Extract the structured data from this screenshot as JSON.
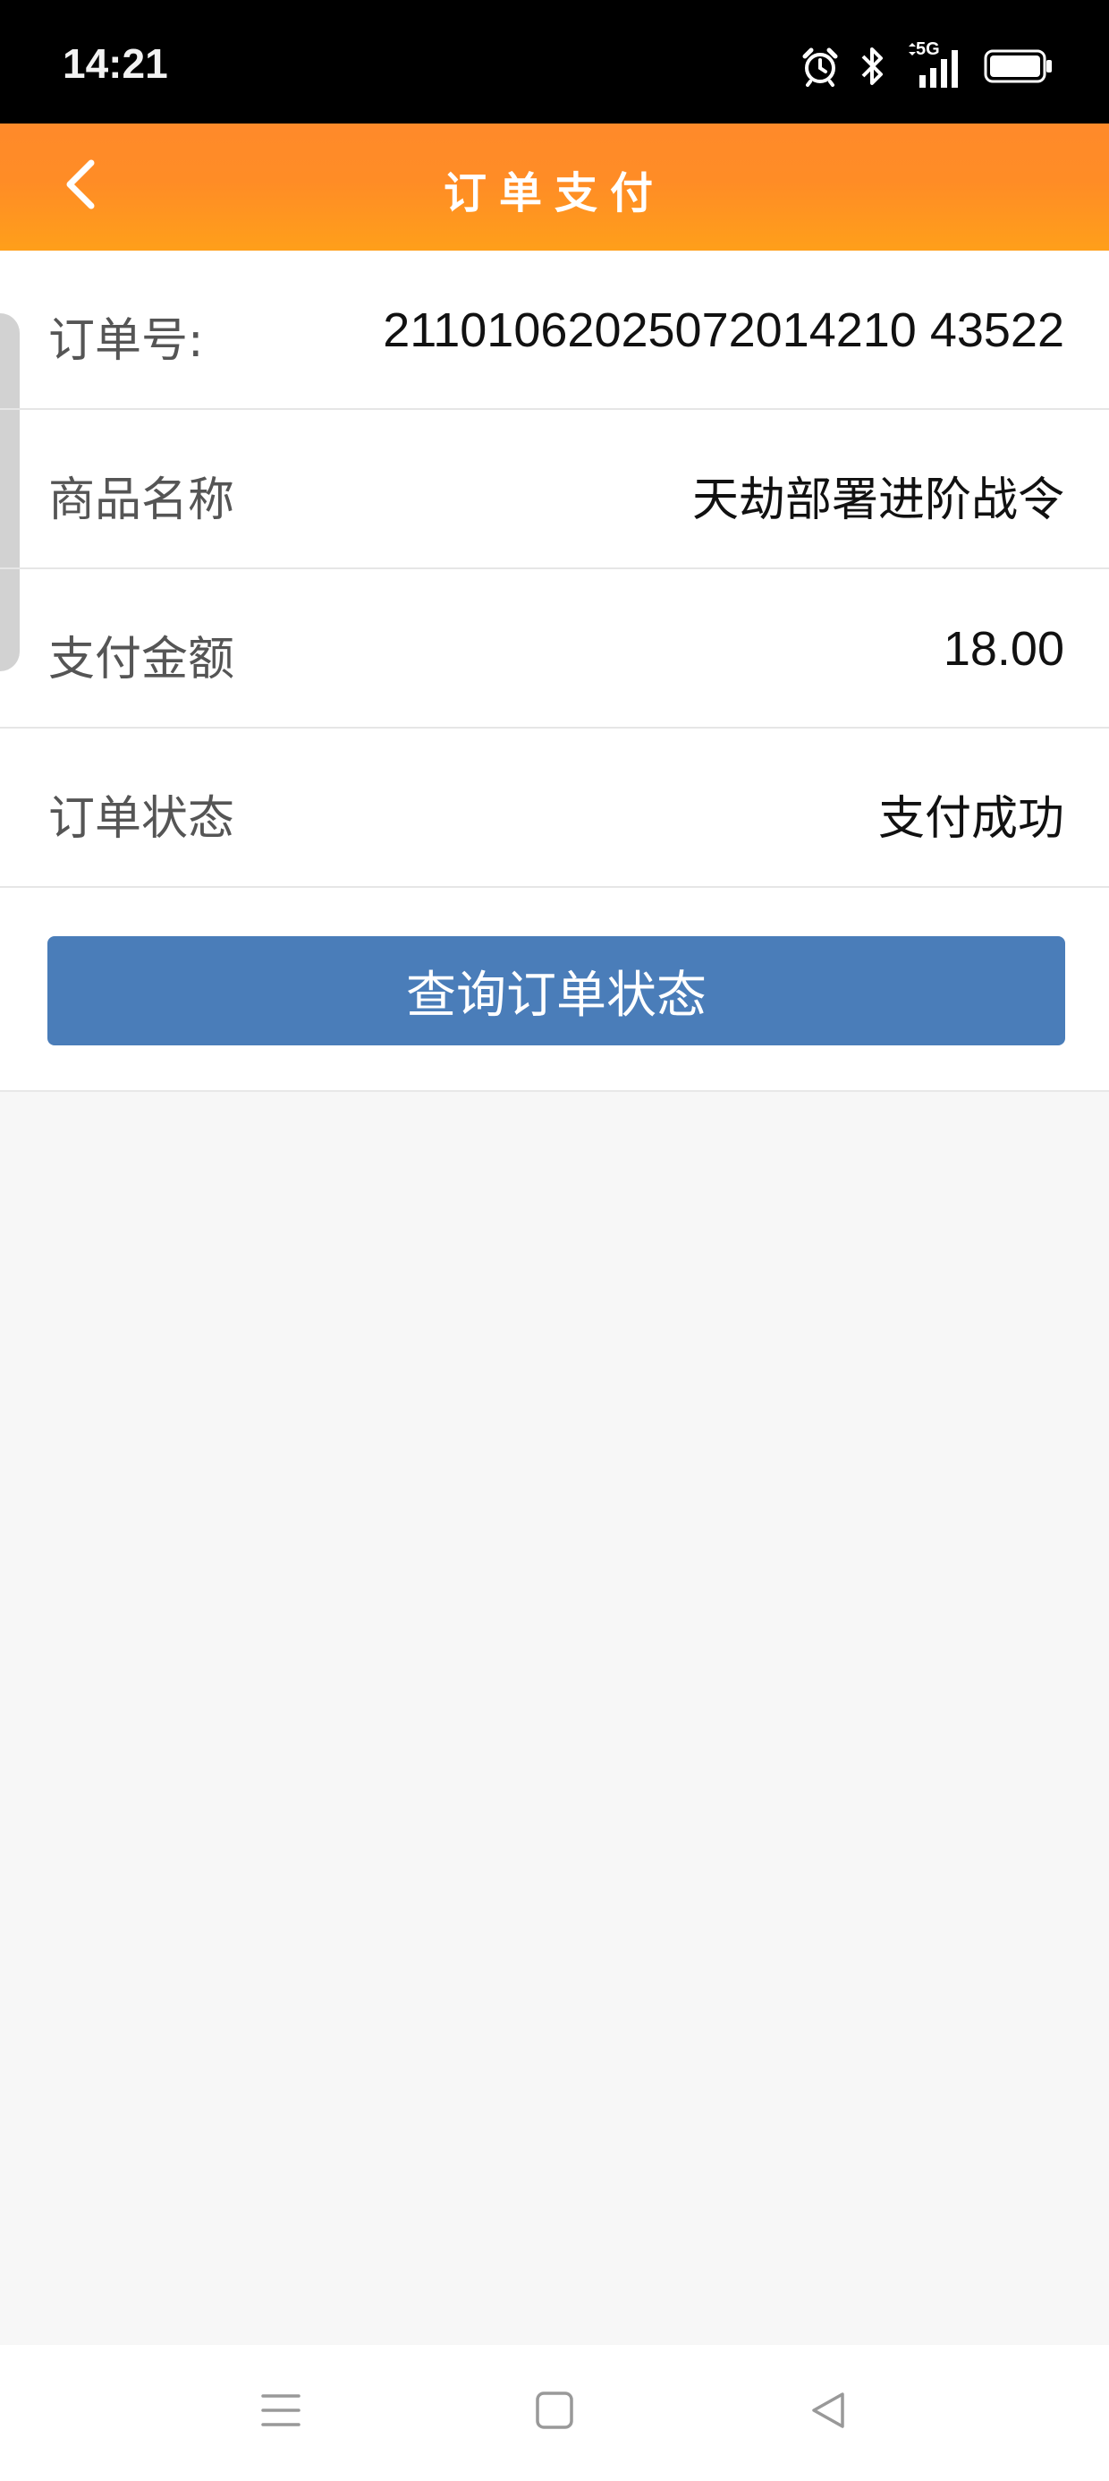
{
  "status_bar": {
    "time": "14:21",
    "network": "5G",
    "icons": [
      "alarm-icon",
      "bluetooth-icon",
      "signal-icon",
      "battery-icon"
    ]
  },
  "header": {
    "title": "订单支付",
    "back_icon": "chevron-left-icon",
    "gradient_colors": [
      "#ff8a2a",
      "#ff9f1a"
    ]
  },
  "order": {
    "rows": [
      {
        "label": "订单号:",
        "value": "21101062025072014210 43522"
      },
      {
        "label": "商品名称",
        "value": "天劫部署进阶战令"
      },
      {
        "label": "支付金额",
        "value": "18.00"
      },
      {
        "label": "订单状态",
        "value": "支付成功"
      }
    ]
  },
  "actions": {
    "query_button_label": "查询订单状态",
    "query_button_color": "#4a7db9"
  },
  "nav": {
    "icons": [
      "menu-icon",
      "home-icon",
      "back-icon"
    ]
  }
}
